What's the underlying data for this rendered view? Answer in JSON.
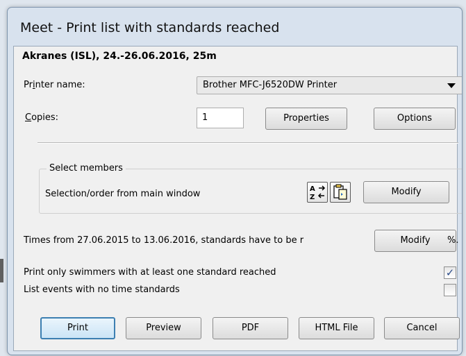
{
  "window": {
    "title": "Meet - Print list with standards reached"
  },
  "meet": {
    "info": "Akranes (ISL), 24.-26.06.2016, 25m"
  },
  "printer": {
    "label_pre": "Pr",
    "label_u": "i",
    "label_post": "nter name:",
    "value": "Brother MFC-J6520DW Printer"
  },
  "copies": {
    "label_u": "C",
    "label_post": "opies:",
    "value": "1"
  },
  "buttons": {
    "properties": "Properties",
    "options": "Options",
    "modify_members": "Modify",
    "modify_times": "Modify",
    "print": "Print",
    "preview": "Preview",
    "pdf": "PDF",
    "html_file": "HTML File",
    "cancel": "Cancel"
  },
  "members": {
    "legend": "Select members",
    "selection": "Selection/order from main window",
    "sort_icon": "sort-az-icon",
    "clipboard_icon": "clipboard-icon"
  },
  "times": {
    "text": "Times from 27.06.2015 to 13.06.2016, standards have to be r",
    "trailing": "%."
  },
  "options": {
    "only_swimmers_label": "Print only swimmers with at least one standard reached",
    "only_swimmers_checked": true,
    "no_standards_label": "List events with no time standards",
    "no_standards_checked": false
  },
  "colors": {
    "title_bar": "#d8e2ee",
    "client": "#f0f0f0",
    "default_button_border": "#3c7fb1",
    "check": "#2a4b89"
  }
}
